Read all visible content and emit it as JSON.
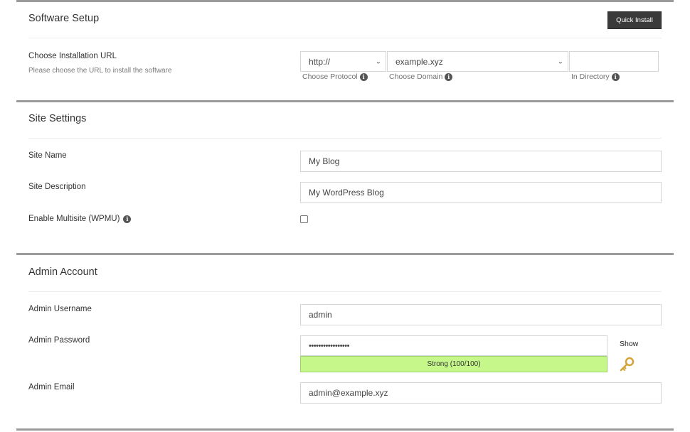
{
  "software_setup": {
    "title": "Software Setup",
    "quick_install_label": "Quick Install",
    "install_url": {
      "label": "Choose Installation URL",
      "sublabel": "Please choose the URL to install the software",
      "protocol_value": "http://",
      "protocol_hint": "Choose Protocol",
      "domain_value": "example.xyz",
      "domain_hint": "Choose Domain",
      "directory_value": "",
      "directory_hint": "In Directory"
    }
  },
  "site_settings": {
    "title": "Site Settings",
    "site_name_label": "Site Name",
    "site_name_value": "My Blog",
    "site_description_label": "Site Description",
    "site_description_value": "My WordPress Blog",
    "multisite_label": "Enable Multisite (WPMU)",
    "multisite_checked": false
  },
  "admin_account": {
    "title": "Admin Account",
    "username_label": "Admin Username",
    "username_value": "admin",
    "password_label": "Admin Password",
    "password_value": "•••••••••••••••••",
    "strength_text": "Strong (100/100)",
    "strength_color": "#c6f78b",
    "show_label": "Show",
    "email_label": "Admin Email",
    "email_value": "admin@example.xyz"
  },
  "icons": {
    "info": "info-circle-icon",
    "chevron": "chevron-down-icon",
    "key": "key-icon"
  }
}
